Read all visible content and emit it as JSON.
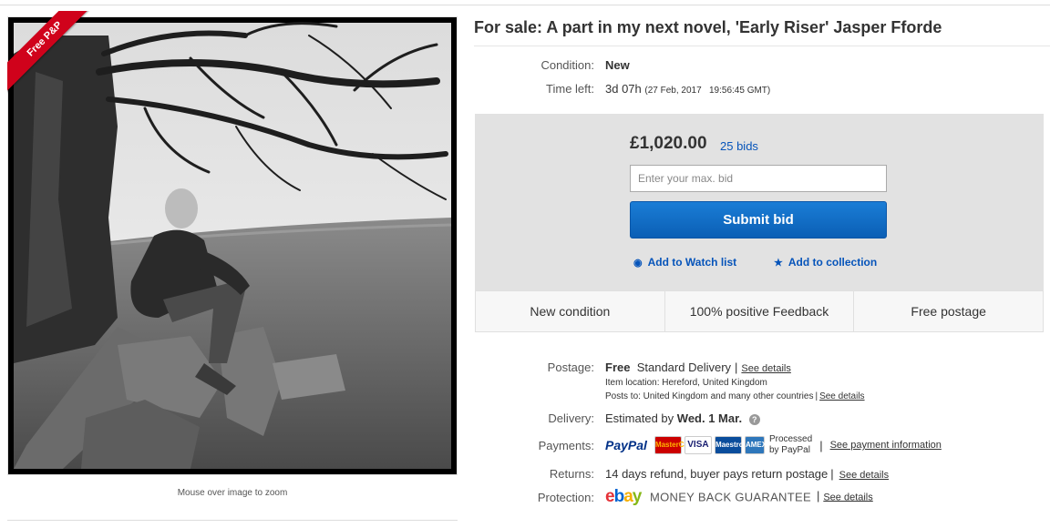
{
  "ribbon": {
    "label": "Free P&P"
  },
  "gallery": {
    "zoom_hint": "Mouse over image to zoom"
  },
  "listing": {
    "title": "For sale: A part in my next novel, 'Early Riser' Jasper Fforde",
    "condition_label": "Condition:",
    "condition_value": "New",
    "time_left_label": "Time left:",
    "time_left_value": "3d 07h",
    "time_left_detail": "(27 Feb, 2017   19:56:45 GMT)"
  },
  "bid": {
    "price": "£1,020.00",
    "bids": "25 bids",
    "input_placeholder": "Enter your max. bid",
    "submit_label": "Submit bid",
    "watch_label": "Add to Watch list",
    "collection_label": "Add to collection"
  },
  "features": [
    "New condition",
    "100% positive Feedback",
    "Free postage"
  ],
  "postage": {
    "label": "Postage:",
    "free": "Free",
    "service": "Standard Delivery",
    "see_details": "See details",
    "item_location": "Item location:  Hereford, United Kingdom",
    "posts_to": "Posts to:  United Kingdom and many other countries",
    "posts_to_details": "See details"
  },
  "delivery": {
    "label": "Delivery:",
    "prefix": "Estimated by",
    "date": "Wed. 1 Mar."
  },
  "payments": {
    "label": "Payments:",
    "paypal": "PayPal",
    "cards": [
      "MasterCard",
      "VISA",
      "Maestro",
      "AMEX"
    ],
    "processed_line1": "Processed",
    "processed_line2": "by PayPal",
    "see_info": "See payment information"
  },
  "returns": {
    "label": "Returns:",
    "text": "14 days refund, buyer pays return postage",
    "see_details": "See details"
  },
  "protection": {
    "label": "Protection:",
    "ebay": "ebay",
    "guarantee": "MONEY BACK GUARANTEE",
    "see_details": "See details"
  },
  "colors": {
    "ebay_e": "#e53238",
    "ebay_b": "#0064d2",
    "ebay_a": "#f5af02",
    "ebay_y": "#86b817",
    "link_blue": "#0654ba",
    "ribbon_red": "#d0021b"
  }
}
